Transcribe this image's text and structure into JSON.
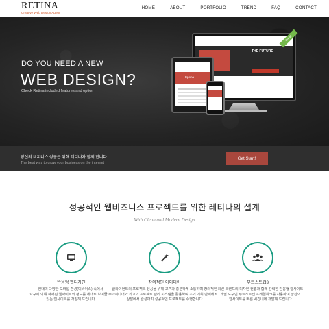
{
  "header": {
    "logo_title": "RETINA",
    "logo_subtitle": "Creative Web Design Agent",
    "nav": [
      "HOME",
      "ABOUT",
      "PORTFOLIO",
      "TREND",
      "FAQ",
      "CONTACT"
    ]
  },
  "hero": {
    "line1": "DO YOU NEED A NEW",
    "line2": "WEB DESIGN?",
    "subtitle": "Check Retina included features and option",
    "monitor_heading": "THE FUTURE",
    "laptop_brand": "Epona",
    "ribbon": "Great!"
  },
  "bar": {
    "line1": "당신의 비지니스 성공은 위해 레티나가 함께 합니다",
    "line2": "The best way to grow your business on the internet",
    "button": "Get Start!"
  },
  "section": {
    "title": "성공적인 웹비즈니스 프로젝트를 위한 레티나의 설계",
    "subtitle": "With Clean and Modern Design"
  },
  "features": [
    {
      "icon": "monitor-icon",
      "title": "반응형 웹디자인"
    },
    {
      "icon": "magic-wand-icon",
      "title": "창의적인 아이디어"
    },
    {
      "icon": "users-icon",
      "title": "부트스트랩3"
    }
  ],
  "description": {
    "col1": [
      "현대의 다양한 모바일 환경(디바이스) 속에서",
      "요구에 의해 적재된 웹사이트의 정보를 제대로 보여줄 수",
      "있는 웹사이트를 개발해 드립니다"
    ],
    "col2": [
      "클라이언트의 프로젝트 성공을 위해 고객과 충분하게 소통하며 창의적인",
      "아이디어와 최고의 프로젝트 관리 시스템을 활용하여 초기 기획 단계에서",
      "상담에서 완성까지 성공적인 프로젝트를 수행합니다"
    ],
    "col3": [
      "최신 트렌드의 디자인 컨셉과 함께 강력한 반응형 웹사이트",
      "개발 도구인 부트스트랩 프레임워크를 사용하여 당신의",
      "웹사이트를 빠른 시간내에 개발해 드립니다"
    ]
  },
  "colors": {
    "accent_teal": "#1a9c82",
    "button_red": "#a9473d",
    "logo_orange": "#d35a2c",
    "ribbon_green": "#74b84b"
  }
}
